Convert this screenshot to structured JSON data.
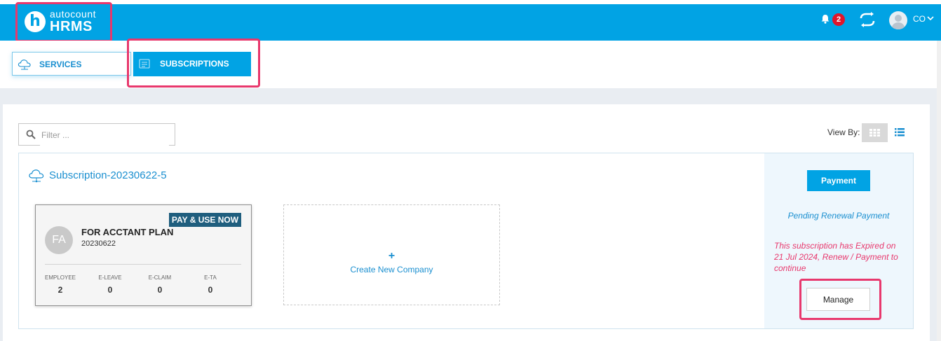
{
  "brand": {
    "logo_letter": "h",
    "top": "autocount",
    "bottom": "HRMS"
  },
  "header": {
    "notification_count": "2",
    "user": "CO"
  },
  "tabs": {
    "services": "SERVICES",
    "subscriptions": "SUBSCRIPTIONS"
  },
  "filter": {
    "placeholder": "Filter ..."
  },
  "view_by": {
    "label": "View By:"
  },
  "subscription": {
    "name": "Subscription-20230622-5",
    "company": {
      "badge": "PAY & USE NOW",
      "initials": "FA",
      "name": "FOR ACCTANT PLAN",
      "code": "20230622",
      "stats": [
        {
          "label": "EMPLOYEE",
          "value": "2"
        },
        {
          "label": "E-LEAVE",
          "value": "0"
        },
        {
          "label": "E-CLAIM",
          "value": "0"
        },
        {
          "label": "E-TA",
          "value": "0"
        }
      ]
    },
    "create": {
      "plus": "+",
      "label": "Create New Company"
    },
    "payment_button": "Payment",
    "pending_text": "Pending Renewal Payment",
    "expired_text": "This subscription has Expired on 21 Jul 2024, Renew / Payment to continue",
    "manage_button": "Manage"
  },
  "colors": {
    "primary": "#01a3e4",
    "highlight": "#e8386d",
    "badge": "#1f5e7e"
  }
}
